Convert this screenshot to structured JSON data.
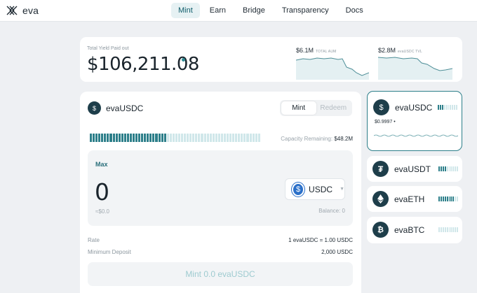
{
  "brand": {
    "name": "eva"
  },
  "nav": {
    "items": [
      "Mint",
      "Earn",
      "Bridge",
      "Transparency",
      "Docs"
    ],
    "active": "Mint"
  },
  "yield": {
    "label": "Total Yield Paid out",
    "value": "$106,211.08",
    "stats": [
      {
        "value": "$6.1M",
        "label": "TOTAL AUM"
      },
      {
        "value": "$2.8M",
        "label": "evaUSDC TVL"
      }
    ]
  },
  "mint": {
    "token": "evaUSDC",
    "token_icon": "dollar-icon",
    "tabs": [
      "Mint",
      "Redeem"
    ],
    "capacity_label": "Capacity Remaining:",
    "capacity_value": "$48.2M",
    "capacity_fraction": 0.45,
    "max_label": "Max",
    "amount": "0",
    "usd_value": "≈$0.0",
    "asset": "USDC",
    "balance": "Balance: 0",
    "rate_label": "Rate",
    "rate_value": "1 evaUSDC = 1.00 USDC",
    "min_label": "Minimum Deposit",
    "min_value": "2,000 USDC",
    "button_label": "Mint 0.0 evaUSDC"
  },
  "vaults": [
    {
      "name": "evaUSDC",
      "icon": "dollar-icon",
      "price": "$0.9997 •",
      "fill": 0.25,
      "selected": true
    },
    {
      "name": "evaUSDT",
      "icon": "tether-icon",
      "fill": 0.35,
      "selected": false
    },
    {
      "name": "evaETH",
      "icon": "ethereum-icon",
      "fill": 0.8,
      "selected": false
    },
    {
      "name": "evaBTC",
      "icon": "bitcoin-icon",
      "fill": 0.0,
      "selected": false
    }
  ],
  "colors": {
    "accent": "#2d7f8a",
    "accent_light": "#d0e7ea",
    "usdc_blue": "#2b70c9"
  }
}
